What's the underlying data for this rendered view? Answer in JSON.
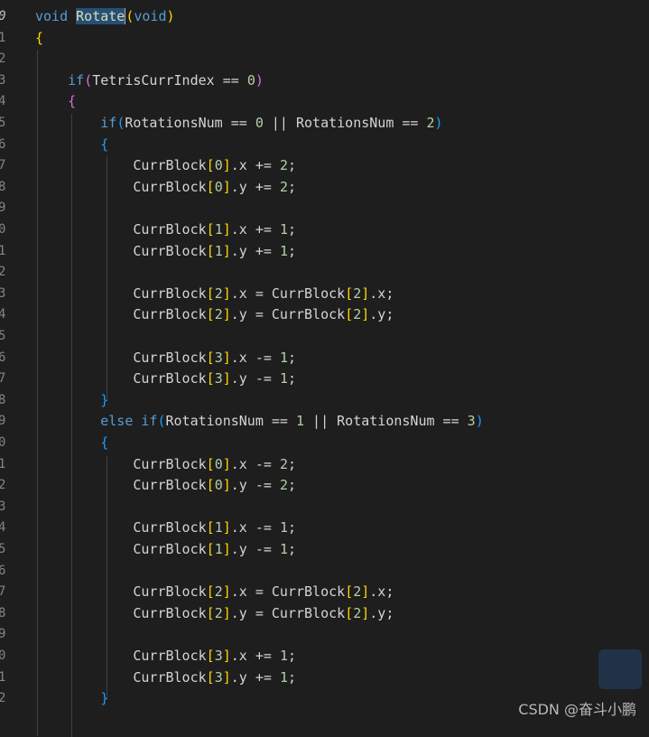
{
  "editor": {
    "lines": [
      {
        "num": "0",
        "tokens": [
          {
            "t": "void",
            "c": "kw"
          },
          {
            "t": " ",
            "c": "var"
          },
          {
            "t": "Rotate",
            "c": "fn sel"
          },
          {
            "t": "(",
            "c": "p1 cursor"
          },
          {
            "t": "void",
            "c": "kw"
          },
          {
            "t": ")",
            "c": "p1"
          }
        ]
      },
      {
        "num": "1",
        "tokens": [
          {
            "t": "{",
            "c": "p1"
          }
        ]
      },
      {
        "num": "2",
        "tokens": []
      },
      {
        "num": "3",
        "tokens": [
          {
            "t": "    if",
            "c": "ctl"
          },
          {
            "t": "(",
            "c": "p2"
          },
          {
            "t": "TetrisCurrIndex",
            "c": "var"
          },
          {
            "t": " == ",
            "c": "op"
          },
          {
            "t": "0",
            "c": "num"
          },
          {
            "t": ")",
            "c": "p2"
          }
        ]
      },
      {
        "num": "4",
        "tokens": [
          {
            "t": "    {",
            "c": "p2"
          }
        ]
      },
      {
        "num": "5",
        "tokens": [
          {
            "t": "        if",
            "c": "ctl"
          },
          {
            "t": "(",
            "c": "p3"
          },
          {
            "t": "RotationsNum",
            "c": "var"
          },
          {
            "t": " == ",
            "c": "op"
          },
          {
            "t": "0",
            "c": "num"
          },
          {
            "t": " || ",
            "c": "op"
          },
          {
            "t": "RotationsNum",
            "c": "var"
          },
          {
            "t": " == ",
            "c": "op"
          },
          {
            "t": "2",
            "c": "num"
          },
          {
            "t": ")",
            "c": "p3"
          }
        ]
      },
      {
        "num": "6",
        "tokens": [
          {
            "t": "        {",
            "c": "p3"
          }
        ]
      },
      {
        "num": "7",
        "tokens": [
          {
            "t": "            CurrBlock",
            "c": "var"
          },
          {
            "t": "[",
            "c": "p1"
          },
          {
            "t": "0",
            "c": "num"
          },
          {
            "t": "]",
            "c": "p1"
          },
          {
            "t": ".x += ",
            "c": "var"
          },
          {
            "t": "2",
            "c": "num"
          },
          {
            "t": ";",
            "c": "var"
          }
        ]
      },
      {
        "num": "8",
        "tokens": [
          {
            "t": "            CurrBlock",
            "c": "var"
          },
          {
            "t": "[",
            "c": "p1"
          },
          {
            "t": "0",
            "c": "num"
          },
          {
            "t": "]",
            "c": "p1"
          },
          {
            "t": ".y += ",
            "c": "var"
          },
          {
            "t": "2",
            "c": "num"
          },
          {
            "t": ";",
            "c": "var"
          }
        ]
      },
      {
        "num": "9",
        "tokens": []
      },
      {
        "num": "0",
        "tokens": [
          {
            "t": "            CurrBlock",
            "c": "var"
          },
          {
            "t": "[",
            "c": "p1"
          },
          {
            "t": "1",
            "c": "num"
          },
          {
            "t": "]",
            "c": "p1"
          },
          {
            "t": ".x += ",
            "c": "var"
          },
          {
            "t": "1",
            "c": "num"
          },
          {
            "t": ";",
            "c": "var"
          }
        ]
      },
      {
        "num": "1",
        "tokens": [
          {
            "t": "            CurrBlock",
            "c": "var"
          },
          {
            "t": "[",
            "c": "p1"
          },
          {
            "t": "1",
            "c": "num"
          },
          {
            "t": "]",
            "c": "p1"
          },
          {
            "t": ".y += ",
            "c": "var"
          },
          {
            "t": "1",
            "c": "num"
          },
          {
            "t": ";",
            "c": "var"
          }
        ]
      },
      {
        "num": "2",
        "tokens": []
      },
      {
        "num": "3",
        "tokens": [
          {
            "t": "            CurrBlock",
            "c": "var"
          },
          {
            "t": "[",
            "c": "p1"
          },
          {
            "t": "2",
            "c": "num"
          },
          {
            "t": "]",
            "c": "p1"
          },
          {
            "t": ".x = CurrBlock",
            "c": "var"
          },
          {
            "t": "[",
            "c": "p1"
          },
          {
            "t": "2",
            "c": "num"
          },
          {
            "t": "]",
            "c": "p1"
          },
          {
            "t": ".x;",
            "c": "var"
          }
        ]
      },
      {
        "num": "4",
        "tokens": [
          {
            "t": "            CurrBlock",
            "c": "var"
          },
          {
            "t": "[",
            "c": "p1"
          },
          {
            "t": "2",
            "c": "num"
          },
          {
            "t": "]",
            "c": "p1"
          },
          {
            "t": ".y = CurrBlock",
            "c": "var"
          },
          {
            "t": "[",
            "c": "p1"
          },
          {
            "t": "2",
            "c": "num"
          },
          {
            "t": "]",
            "c": "p1"
          },
          {
            "t": ".y;",
            "c": "var"
          }
        ]
      },
      {
        "num": "5",
        "tokens": []
      },
      {
        "num": "6",
        "tokens": [
          {
            "t": "            CurrBlock",
            "c": "var"
          },
          {
            "t": "[",
            "c": "p1"
          },
          {
            "t": "3",
            "c": "num"
          },
          {
            "t": "]",
            "c": "p1"
          },
          {
            "t": ".x -= ",
            "c": "var"
          },
          {
            "t": "1",
            "c": "num"
          },
          {
            "t": ";",
            "c": "var"
          }
        ]
      },
      {
        "num": "7",
        "tokens": [
          {
            "t": "            CurrBlock",
            "c": "var"
          },
          {
            "t": "[",
            "c": "p1"
          },
          {
            "t": "3",
            "c": "num"
          },
          {
            "t": "]",
            "c": "p1"
          },
          {
            "t": ".y -= ",
            "c": "var"
          },
          {
            "t": "1",
            "c": "num"
          },
          {
            "t": ";",
            "c": "var"
          }
        ]
      },
      {
        "num": "8",
        "tokens": [
          {
            "t": "        }",
            "c": "p3"
          }
        ]
      },
      {
        "num": "9",
        "tokens": [
          {
            "t": "        else if",
            "c": "ctl"
          },
          {
            "t": "(",
            "c": "p3"
          },
          {
            "t": "RotationsNum",
            "c": "var"
          },
          {
            "t": " == ",
            "c": "op"
          },
          {
            "t": "1",
            "c": "num"
          },
          {
            "t": " || ",
            "c": "op"
          },
          {
            "t": "RotationsNum",
            "c": "var"
          },
          {
            "t": " == ",
            "c": "op"
          },
          {
            "t": "3",
            "c": "num"
          },
          {
            "t": ")",
            "c": "p3"
          }
        ]
      },
      {
        "num": "0",
        "tokens": [
          {
            "t": "        {",
            "c": "p3"
          }
        ]
      },
      {
        "num": "1",
        "tokens": [
          {
            "t": "            CurrBlock",
            "c": "var"
          },
          {
            "t": "[",
            "c": "p1"
          },
          {
            "t": "0",
            "c": "num"
          },
          {
            "t": "]",
            "c": "p1"
          },
          {
            "t": ".x -= ",
            "c": "var"
          },
          {
            "t": "2",
            "c": "num"
          },
          {
            "t": ";",
            "c": "var"
          }
        ]
      },
      {
        "num": "2",
        "tokens": [
          {
            "t": "            CurrBlock",
            "c": "var"
          },
          {
            "t": "[",
            "c": "p1"
          },
          {
            "t": "0",
            "c": "num"
          },
          {
            "t": "]",
            "c": "p1"
          },
          {
            "t": ".y -= ",
            "c": "var"
          },
          {
            "t": "2",
            "c": "num"
          },
          {
            "t": ";",
            "c": "var"
          }
        ]
      },
      {
        "num": "3",
        "tokens": []
      },
      {
        "num": "4",
        "tokens": [
          {
            "t": "            CurrBlock",
            "c": "var"
          },
          {
            "t": "[",
            "c": "p1"
          },
          {
            "t": "1",
            "c": "num"
          },
          {
            "t": "]",
            "c": "p1"
          },
          {
            "t": ".x -= ",
            "c": "var"
          },
          {
            "t": "1",
            "c": "num"
          },
          {
            "t": ";",
            "c": "var"
          }
        ]
      },
      {
        "num": "5",
        "tokens": [
          {
            "t": "            CurrBlock",
            "c": "var"
          },
          {
            "t": "[",
            "c": "p1"
          },
          {
            "t": "1",
            "c": "num"
          },
          {
            "t": "]",
            "c": "p1"
          },
          {
            "t": ".y -= ",
            "c": "var"
          },
          {
            "t": "1",
            "c": "num"
          },
          {
            "t": ";",
            "c": "var"
          }
        ]
      },
      {
        "num": "6",
        "tokens": []
      },
      {
        "num": "7",
        "tokens": [
          {
            "t": "            CurrBlock",
            "c": "var"
          },
          {
            "t": "[",
            "c": "p1"
          },
          {
            "t": "2",
            "c": "num"
          },
          {
            "t": "]",
            "c": "p1"
          },
          {
            "t": ".x = CurrBlock",
            "c": "var"
          },
          {
            "t": "[",
            "c": "p1"
          },
          {
            "t": "2",
            "c": "num"
          },
          {
            "t": "]",
            "c": "p1"
          },
          {
            "t": ".x;",
            "c": "var"
          }
        ]
      },
      {
        "num": "8",
        "tokens": [
          {
            "t": "            CurrBlock",
            "c": "var"
          },
          {
            "t": "[",
            "c": "p1"
          },
          {
            "t": "2",
            "c": "num"
          },
          {
            "t": "]",
            "c": "p1"
          },
          {
            "t": ".y = CurrBlock",
            "c": "var"
          },
          {
            "t": "[",
            "c": "p1"
          },
          {
            "t": "2",
            "c": "num"
          },
          {
            "t": "]",
            "c": "p1"
          },
          {
            "t": ".y;",
            "c": "var"
          }
        ]
      },
      {
        "num": "9",
        "tokens": []
      },
      {
        "num": "0",
        "tokens": [
          {
            "t": "            CurrBlock",
            "c": "var"
          },
          {
            "t": "[",
            "c": "p1"
          },
          {
            "t": "3",
            "c": "num"
          },
          {
            "t": "]",
            "c": "p1"
          },
          {
            "t": ".x += ",
            "c": "var"
          },
          {
            "t": "1",
            "c": "num"
          },
          {
            "t": ";",
            "c": "var"
          }
        ]
      },
      {
        "num": "1",
        "tokens": [
          {
            "t": "            CurrBlock",
            "c": "var"
          },
          {
            "t": "[",
            "c": "p1"
          },
          {
            "t": "3",
            "c": "num"
          },
          {
            "t": "]",
            "c": "p1"
          },
          {
            "t": ".y += ",
            "c": "var"
          },
          {
            "t": "1",
            "c": "num"
          },
          {
            "t": ";",
            "c": "var"
          }
        ]
      },
      {
        "num": "2",
        "tokens": [
          {
            "t": "        }",
            "c": "p3"
          }
        ]
      }
    ]
  },
  "watermark": "CSDN @奋斗小鹏",
  "colors": {
    "background": "#1e1e1e",
    "keyword": "#569cd6",
    "function": "#dcdcaa",
    "number": "#b5cea8",
    "bracket1": "#ffd700",
    "bracket2": "#da70d6",
    "bracket3": "#179fff",
    "selection": "#264f78"
  }
}
